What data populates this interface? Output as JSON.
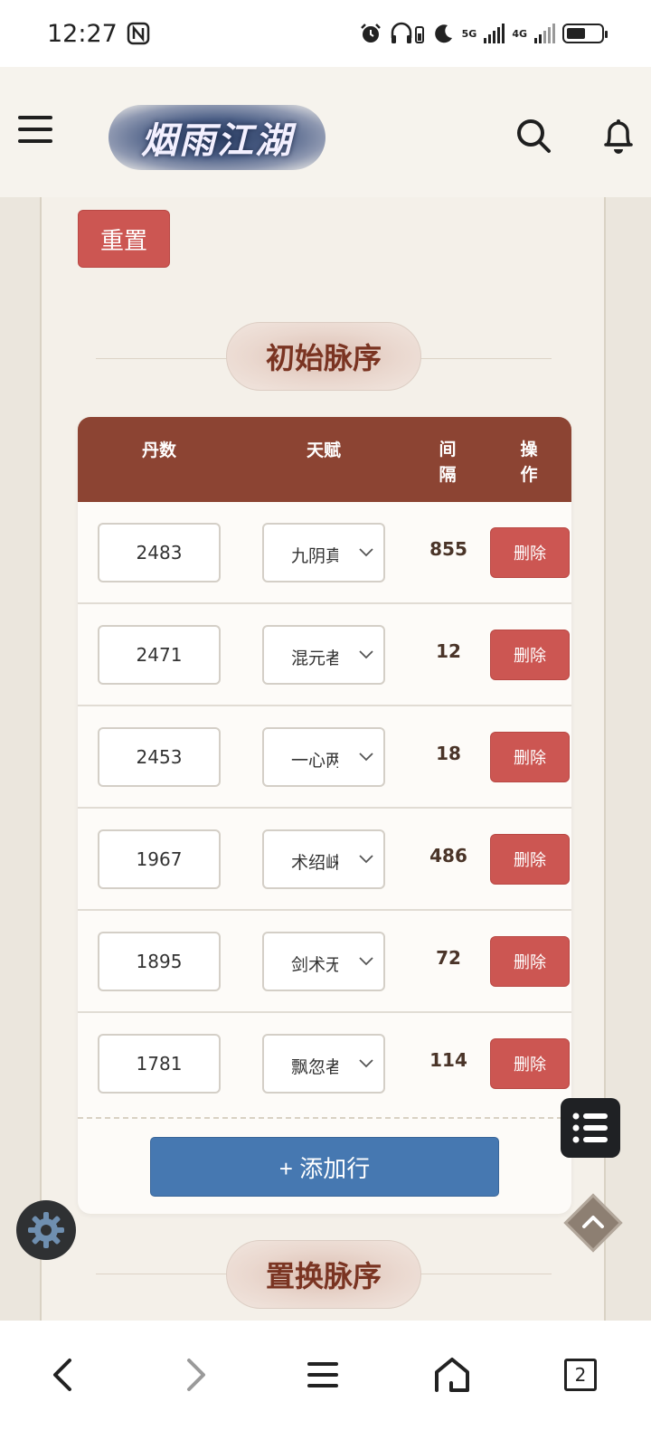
{
  "status_bar": {
    "time": "12:27",
    "network_5g": "5G",
    "network_4g": "4G"
  },
  "header": {
    "logo_text": "烟雨江湖"
  },
  "controls": {
    "reset_label": "重置"
  },
  "section_initial": {
    "title": "初始脉序"
  },
  "section_replace": {
    "title": "置换脉序"
  },
  "table": {
    "headers": {
      "dan_shu": "丹数",
      "tian_fu": "天赋",
      "jian_ge_1": "间",
      "jian_ge_2": "隔",
      "cao_zuo_1": "操",
      "cao_zuo_2": "作"
    },
    "rows": [
      {
        "dan": "2483",
        "talent": "九阴真",
        "gap": "855",
        "delete": "删除"
      },
      {
        "dan": "2471",
        "talent": "混元者",
        "gap": "12",
        "delete": "删除"
      },
      {
        "dan": "2453",
        "talent": "一心两",
        "gap": "18",
        "delete": "删除"
      },
      {
        "dan": "1967",
        "talent": "术绍崃",
        "gap": "486",
        "delete": "删除"
      },
      {
        "dan": "1895",
        "talent": "剑术无",
        "gap": "72",
        "delete": "删除"
      },
      {
        "dan": "1781",
        "talent": "飘忽者",
        "gap": "114",
        "delete": "删除"
      }
    ],
    "add_row_label": "+ 添加行"
  },
  "nav_bar": {
    "tabs_count": "2"
  },
  "colors": {
    "header_brown": "#8c4433",
    "danger_red": "#cc5652",
    "primary_blue": "#4678b1",
    "title_text": "#7a3422"
  }
}
